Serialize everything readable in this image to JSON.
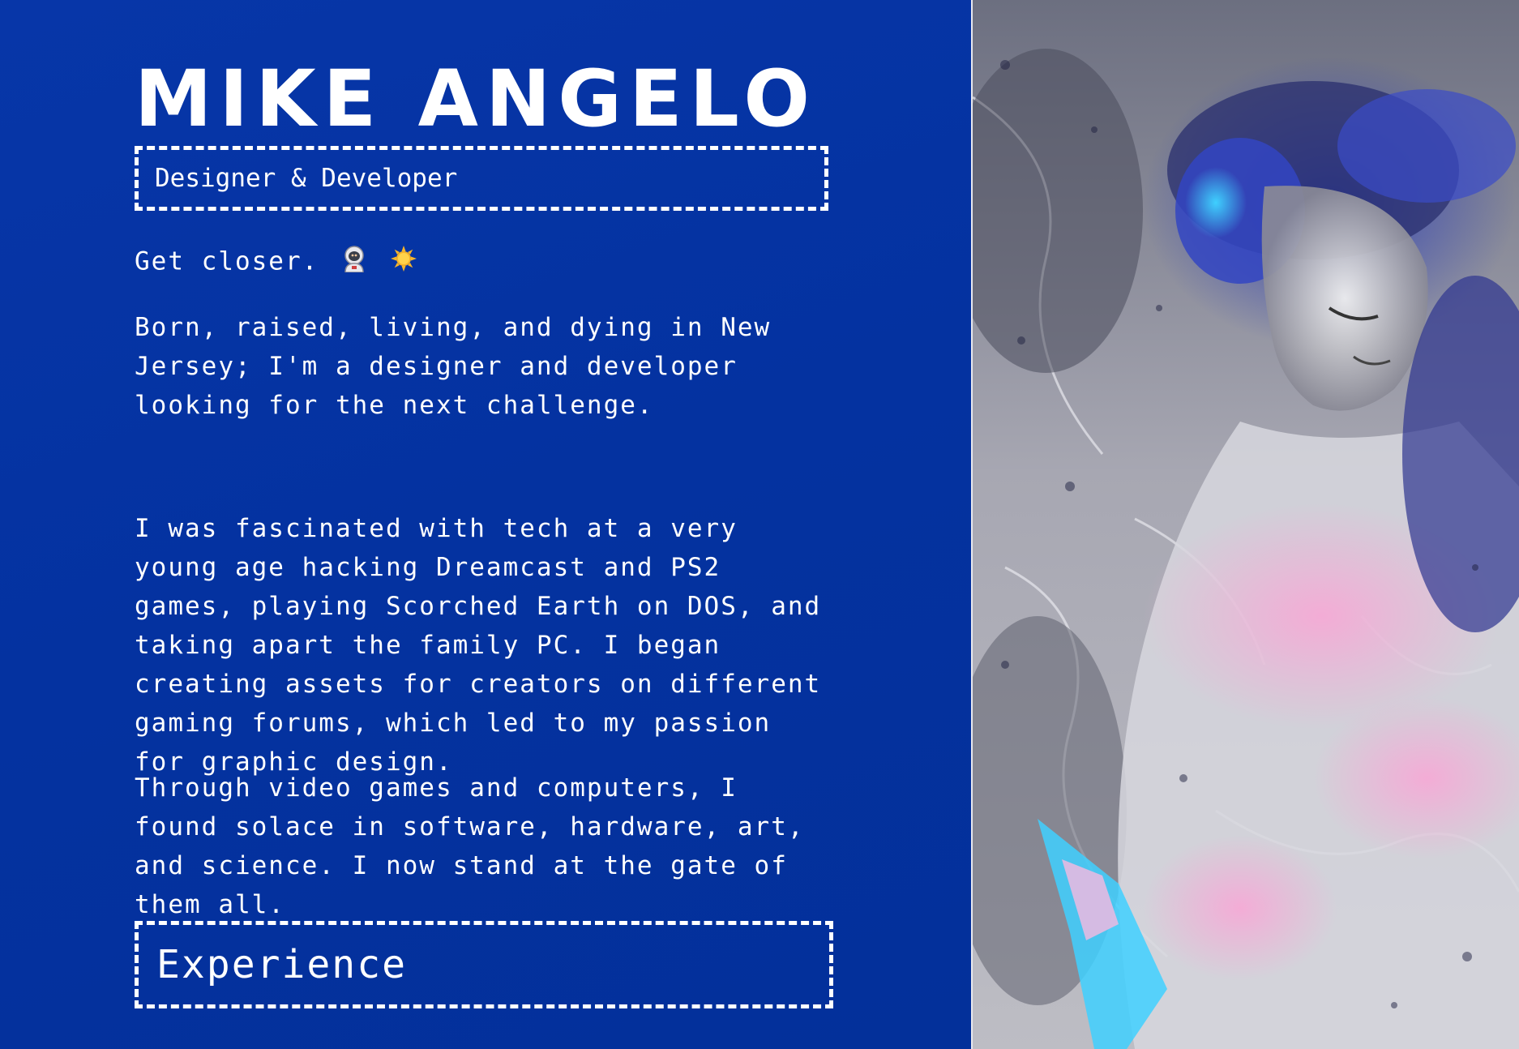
{
  "profile": {
    "name": "MIKE ANGELO",
    "role": "Designer & Developer",
    "tagline": "Get closer.",
    "tagline_icons": [
      "astronaut-icon",
      "sun-icon"
    ]
  },
  "about": {
    "paragraphs": [
      "Born, raised, living, and dying in New Jersey; I'm a designer and developer looking for the next challenge.",
      "I was fascinated with tech at a very young age hacking Dreamcast and PS2 games, playing Scorched Earth on DOS, and taking apart the family PC. I began creating assets for creators on different gaming forums, which led to my passion for graphic design.",
      "Through video games and computers, I found solace in software, hardware, art, and science. I now stand at the gate of them all."
    ]
  },
  "sections": {
    "experience_label": "Experience"
  },
  "colors": {
    "background": "#0432a0",
    "text": "#ffffff",
    "accent_pink": "#f0a0d0",
    "accent_cyan": "#40c8f0"
  }
}
